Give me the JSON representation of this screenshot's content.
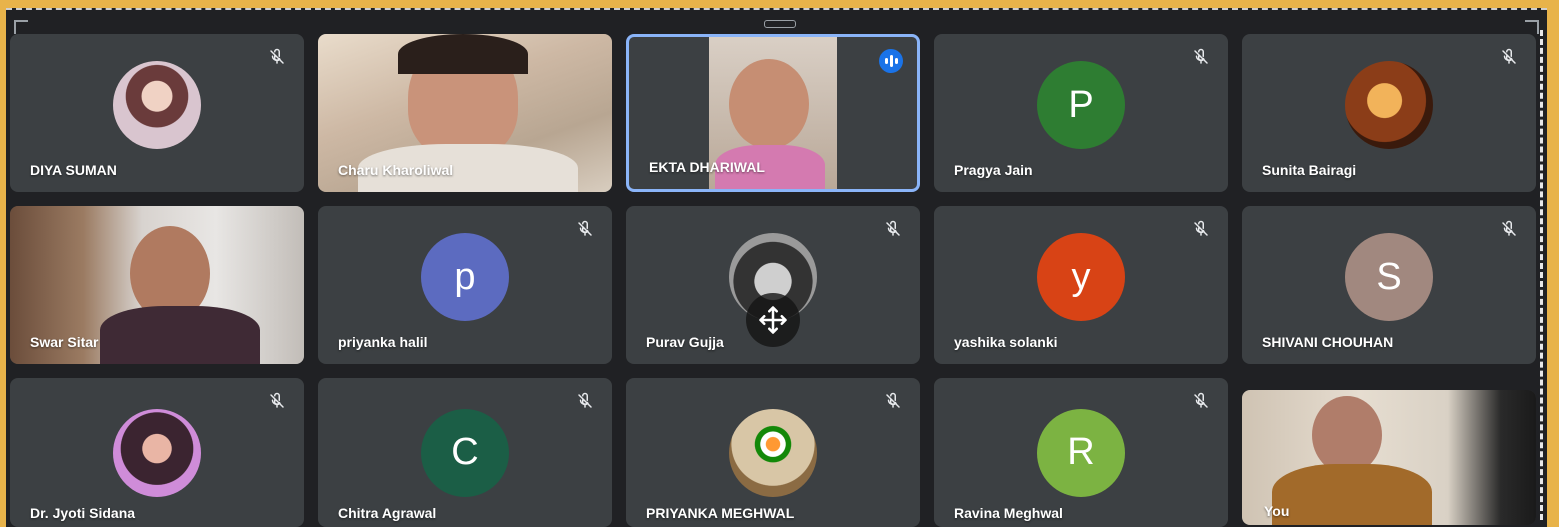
{
  "colors": {
    "outer_frame": "#e8b34a",
    "grid_background": "#202124",
    "tile_background": "#3c4043",
    "active_speaker_border": "#8ab4f8",
    "speaking_indicator": "#1a73e8"
  },
  "participants": [
    {
      "name": "DIYA SUMAN",
      "type": "photo-avatar",
      "muted": true
    },
    {
      "name": "Charu Kharoliwal",
      "type": "video",
      "muted": false
    },
    {
      "name": "EKTA DHARIWAL",
      "type": "video",
      "muted": false,
      "speaking": true
    },
    {
      "name": "Pragya Jain",
      "type": "letter-avatar",
      "initial": "P",
      "avatar_color": "#2e7d32",
      "muted": true
    },
    {
      "name": "Sunita Bairagi",
      "type": "photo-avatar",
      "muted": true
    },
    {
      "name": "Swar Sitar",
      "type": "video",
      "muted": false
    },
    {
      "name": "priyanka halil",
      "type": "letter-avatar",
      "initial": "p",
      "avatar_color": "#5c6bc0",
      "muted": true
    },
    {
      "name": "Purav Gujja",
      "type": "photo-avatar",
      "muted": true
    },
    {
      "name": "yashika solanki",
      "type": "letter-avatar",
      "initial": "y",
      "avatar_color": "#d84315",
      "muted": true
    },
    {
      "name": "SHIVANI CHOUHAN",
      "type": "letter-avatar",
      "initial": "S",
      "avatar_color": "#a1887f",
      "muted": true
    },
    {
      "name": "Dr. Jyoti Sidana",
      "type": "photo-avatar",
      "muted": true
    },
    {
      "name": "Chitra Agrawal",
      "type": "letter-avatar",
      "initial": "C",
      "avatar_color": "#1b5e46",
      "muted": true
    },
    {
      "name": "PRIYANKA MEGHWAL",
      "type": "photo-avatar",
      "muted": true
    },
    {
      "name": "Ravina Meghwal",
      "type": "letter-avatar",
      "initial": "R",
      "avatar_color": "#7cb342",
      "muted": true
    },
    {
      "name": "You",
      "type": "video",
      "muted": false
    }
  ],
  "icons": {
    "mute": "mic-off-icon",
    "speaking": "audio-level-icon",
    "move": "move-arrows-icon"
  }
}
